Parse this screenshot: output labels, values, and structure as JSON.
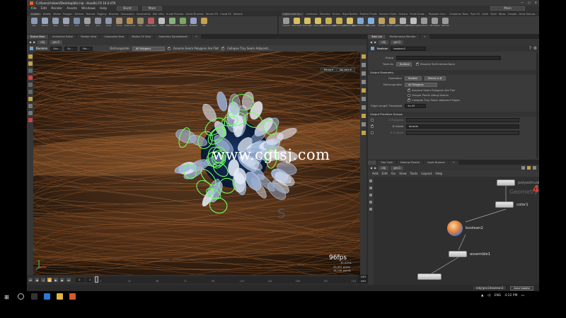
{
  "window": {
    "title": "C:/Users/chebert/Desktop/bits.hip - Houdini FX 16.0.479",
    "minimize": "—",
    "maximize": "☐",
    "close": "✕"
  },
  "menu": {
    "items": [
      "File",
      "Edit",
      "Render",
      "Assets",
      "Windows",
      "Help"
    ],
    "desktop_left": "Build",
    "desktop_right": "Main",
    "desktop_far": "Main"
  },
  "shelf": {
    "left_tabs": [
      "Create",
      "Modify",
      "Model",
      "Polygon",
      "Deform",
      "Texture",
      "Rigging",
      "Muscles",
      "Characters",
      "Constraints",
      "Hair Utils",
      "Guide Process",
      "Guide Brushes",
      "Terrain FX",
      "Cloud FX",
      "Volume"
    ],
    "left_tools": [
      {
        "label": "Box",
        "color": "#8a9bb8"
      },
      {
        "label": "Sphere",
        "color": "#9aa8c0"
      },
      {
        "label": "Tube",
        "color": "#8f9eb5"
      },
      {
        "label": "Torus",
        "color": "#a3a3b7"
      },
      {
        "label": "Grid",
        "color": "#7b8ea9"
      },
      {
        "label": "Null",
        "color": "#a0a0a0"
      },
      {
        "label": "Line",
        "color": "#9090a0"
      },
      {
        "label": "Circle",
        "color": "#8c98ae"
      },
      {
        "label": "Curve",
        "color": "#a88f70"
      },
      {
        "label": "Draw Curve",
        "color": "#b88a4a"
      },
      {
        "label": "Path",
        "color": "#9a8a6a"
      },
      {
        "label": "Spray Paint",
        "color": "#b85a5a"
      },
      {
        "label": "Font",
        "color": "#c0c0c0"
      },
      {
        "label": "Platonic Solids",
        "color": "#8db07a"
      },
      {
        "label": "L-System",
        "color": "#7aa860"
      },
      {
        "label": "Metaball",
        "color": "#9aa0c8"
      },
      {
        "label": "File",
        "color": "#c8a050"
      }
    ],
    "right_tabs": [
      "Lights and Ca...",
      "Collisions",
      "Particles",
      "Grains",
      "Rigid Bodies",
      "Particle Fluids",
      "Viscous Fluids",
      "Oceans",
      "Fluid Conta...",
      "Populate Con...",
      "Container Tools",
      "Pyro FX",
      "Cloth",
      "Solid",
      "Wires",
      "Crowds",
      "Drive Simula..."
    ],
    "right_tools": [
      {
        "label": "Camera",
        "color": "#9a9a9a"
      },
      {
        "label": "Point Light",
        "color": "#d8c060"
      },
      {
        "label": "Spot Light",
        "color": "#d8c060"
      },
      {
        "label": "Area Light",
        "color": "#d8c060"
      },
      {
        "label": "Geometry Light",
        "color": "#c8b050"
      },
      {
        "label": "Volume Light",
        "color": "#c8b050"
      },
      {
        "label": "Distant Light",
        "color": "#d8c060"
      },
      {
        "label": "Environment Light",
        "color": "#80a8d0"
      },
      {
        "label": "Sky Light",
        "color": "#80b0e0"
      },
      {
        "label": "GI Light",
        "color": "#c0a060"
      },
      {
        "label": "Caustic Light",
        "color": "#c0a060"
      },
      {
        "label": "Portal Light",
        "color": "#b0b0b0"
      },
      {
        "label": "Ambient Light",
        "color": "#c0c0c0"
      },
      {
        "label": "Camera",
        "color": "#9a9a9a"
      },
      {
        "label": "VR Camera",
        "color": "#9a9a9a"
      },
      {
        "label": "Switcher",
        "color": "#9a9a9a"
      }
    ]
  },
  "left_pane": {
    "tabs": [
      "Scene View",
      "Animation Editor",
      "Render View",
      "Composite View",
      "Motion FX View",
      "Geometry Spreadsheet"
    ],
    "path": [
      "obj",
      "geo1"
    ],
    "op_bar": {
      "node_name": "Boolean",
      "group_field": "Gro...",
      "a_field": "Sc...",
      "b_field": "Poi...",
      "detriangulate_label": "Detriangulate",
      "detriangulate_value": "All Polygons",
      "assume_seam_label": "Assume Seam Polygons Are Flat",
      "collapse_label": "Collapse Tiny Seam Adjacent..."
    },
    "view_menu": "Persp ▾",
    "cam_menu": "No cam ▾",
    "fps": "96fps",
    "ms": "10.41ms",
    "prims": "20,092  prims",
    "points": "16,146  points"
  },
  "timeline": {
    "frame": "1",
    "start": "1",
    "end": "240",
    "end2": "240",
    "markers": [
      "1",
      "24",
      "48",
      "72",
      "96",
      "120",
      "144",
      "168",
      "192",
      "216",
      "240"
    ],
    "auto_update": "Auto Update",
    "status": "/obj/geo1/boolean2"
  },
  "right_top": {
    "tabs": [
      "Take List",
      "Performance Monitor"
    ],
    "path": [
      "obj",
      "geo1"
    ],
    "node_type": "Boolean",
    "node_name": "boolean2",
    "group_label": "Group",
    "treat_as_label": "Treat As",
    "treat_as_value": "Surface",
    "resolve_label": "Resolve Self-Intersections",
    "output_geometry": "Output Geometry",
    "operation_label": "Operation",
    "operation_value": "Shatter",
    "pieces_value": "Pieces in B",
    "detriangulate_label": "Detriangulate",
    "detriangulate_value": "All Polygons",
    "assume_label": "Assume Seam Polygons Are Flat",
    "unique_label": "Unique Points Along Seams",
    "collapse_label": "Collapse Tiny Seam Adjacent Edges",
    "edge_label": "Edge Length Threshold",
    "edge_value": "1e-05",
    "output_groups": "Output Primitive Groups",
    "row_a": "A Polygons",
    "row_b": "B Inside",
    "row_b_value": "binside",
    "row_c": "B Outside"
  },
  "right_bottom": {
    "tabs": [
      "Tree View",
      "Material Palette",
      "Asset Browser"
    ],
    "path": [
      "obj",
      "geo1"
    ],
    "menu": [
      "Add",
      "Edit",
      "Go",
      "View",
      "Tools",
      "Layout",
      "Help"
    ],
    "context_label": "Geometry",
    "nodes": {
      "polyextrude": "polyextrude",
      "color": "color1",
      "boolean": "boolean2",
      "assemble": "assemble1"
    }
  },
  "watermark": "www.cgtsj.com",
  "taskbar": {
    "lang": "ENG",
    "time": "4:22 PM"
  }
}
